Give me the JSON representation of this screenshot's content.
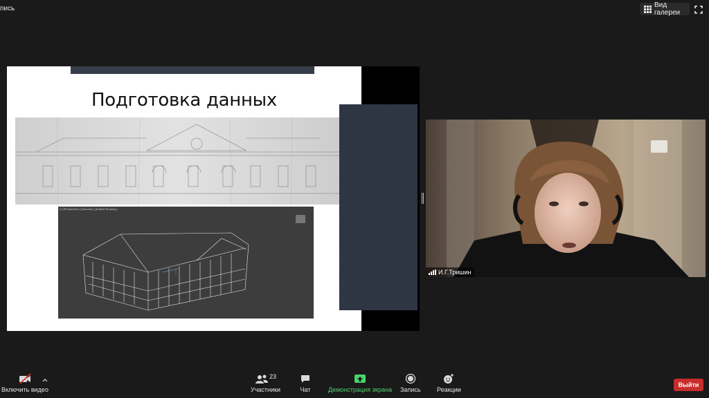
{
  "top": {
    "left_label": "пись",
    "gallery_label": "Вид галереи"
  },
  "slide": {
    "title": "Подготовка данных",
    "viewport_label": "[+] [Perspective ] [Standard ] [Default Shading ]"
  },
  "video": {
    "participant_name": "И.Г.Тришин"
  },
  "toolbar": {
    "video_label": "Включить видео",
    "participants_label": "Участники",
    "participants_count": "23",
    "chat_label": "Чат",
    "share_label": "Демонстрация экрана",
    "record_label": "Запись",
    "reactions_label": "Реакции",
    "leave_label": "Выйти"
  },
  "colors": {
    "background": "#1a1a1a",
    "share_green": "#4cd26b",
    "leave_red": "#c82d2d",
    "slide_accent": "#363d4a"
  },
  "icons": [
    "grid-icon",
    "fullscreen-icon",
    "camera-off-icon",
    "chevron-up-icon",
    "participants-icon",
    "chat-icon",
    "share-screen-icon",
    "record-icon",
    "reactions-icon",
    "signal-icon"
  ]
}
